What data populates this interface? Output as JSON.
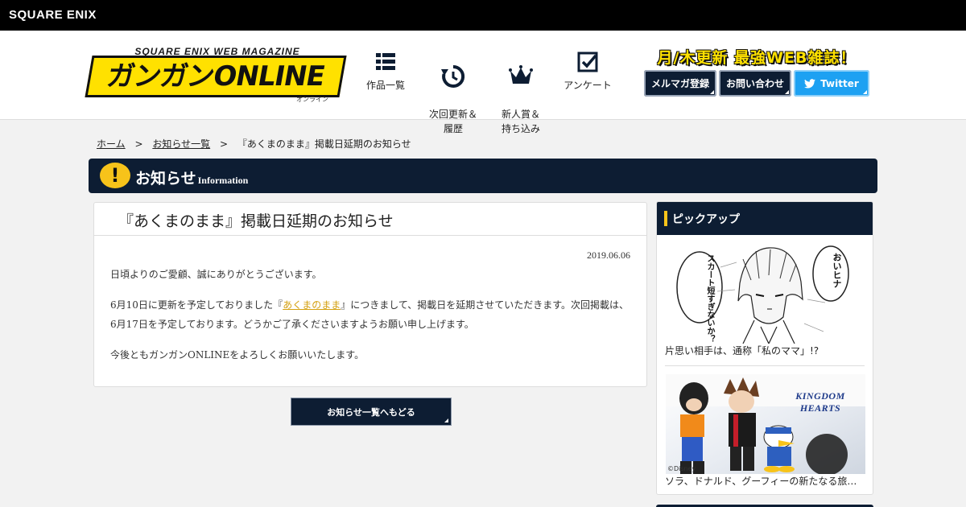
{
  "topbar": {
    "brand": "SQUARE ENIX"
  },
  "header": {
    "logo_sub": "SQUARE ENIX WEB MAGAZINE",
    "logo_main": "ガンガンONLINE",
    "logo_ruby": "オンライン",
    "nav": [
      {
        "label": "作品一覧",
        "icon": "grid-list-icon"
      },
      {
        "label": "次回更新＆\n履歴",
        "icon": "refresh-clock-icon"
      },
      {
        "label": "新人賞＆\n持ち込み",
        "icon": "crown-icon"
      },
      {
        "label": "アンケート",
        "icon": "checkbox-icon"
      }
    ],
    "tagline": "月/木更新 最強WEB雑誌！",
    "buttons": {
      "mailmag": "メルマガ登録",
      "contact": "お問い合わせ",
      "twitter": "Twitter"
    }
  },
  "breadcrumb": {
    "home": "ホーム",
    "sep": ">",
    "list": "お知らせ一覧",
    "current": "『あくまのまま』掲載日延期のお知らせ"
  },
  "section": {
    "title": "お知らせ",
    "title_en": "Information",
    "icon_glyph": "!"
  },
  "article": {
    "title": "『あくまのまま』掲載日延期のお知らせ",
    "date": "2019.06.06",
    "p1": "日頃よりのご愛顧、誠にありがとうございます。",
    "p2_before": "6月10日に更新を予定しておりました『",
    "p2_link": "あくまのまま",
    "p2_after": "』につきまして、掲載日を延期させていただきます。次回掲載は、6月17日を予定しております。どうかご了承くださいますようお願い申し上げます。",
    "p3": "今後ともガンガンONLINEをよろしくお願いいたします。"
  },
  "back_button": "お知らせ一覧へもどる",
  "pickup": {
    "heading": "ピックアップ",
    "items": [
      {
        "caption": "片思い相手は、通称「私のママ」!?",
        "bubble_left": "スカート短すぎないか？",
        "bubble_right": "おいヒナ"
      },
      {
        "caption": "ソラ、ドナルド、グーフィーの新たなる旅…",
        "logo_text": "KINGDOM HEARTS",
        "copyright": "©Disney"
      }
    ]
  },
  "colors": {
    "navy": "#0d1d33",
    "accent_yellow": "#f7c31a",
    "twitter_blue": "#1da1f2",
    "link_gold": "#d4a010"
  }
}
